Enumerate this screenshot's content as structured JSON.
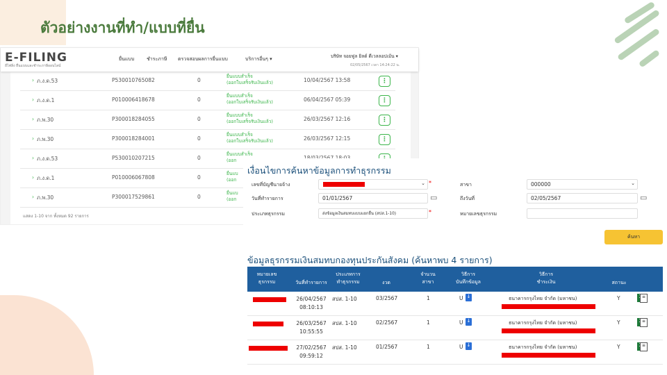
{
  "slide_title": "ตัวอย่างงานที่ทำ/แบบที่ยื่น",
  "efiling": {
    "logo": "E-FILING",
    "logo_sub": "อีไฟลิ่ง ยื่นแบบและชำระภาษีออนไลน์",
    "nav": [
      "ยื่นแบบ",
      "ชำระภาษี",
      "ตรวจสอบผลการยื่นแบบ",
      "บริการอื่นๆ ▾"
    ],
    "user": "บริษัท จอยฟูล ยิลด์ ดีเวลลอปเม้น ▾",
    "user_datetime": "02/05/2567 เวลา 14:24:22 น.",
    "rows": [
      {
        "form": "ภ.ง.ด.53",
        "ref": "P530010765082",
        "amount": "0",
        "status1": "ยื่นแบบสำเร็จ",
        "status2": "(ออกใบเสร็จรับเงินแล้ว)",
        "datetime": "10/04/2567 13:58"
      },
      {
        "form": "ภ.ง.ด.1",
        "ref": "P010006418678",
        "amount": "0",
        "status1": "ยื่นแบบสำเร็จ",
        "status2": "(ออกใบเสร็จรับเงินแล้ว)",
        "datetime": "06/04/2567 05:39"
      },
      {
        "form": "ภ.พ.30",
        "ref": "P300018284055",
        "amount": "0",
        "status1": "ยื่นแบบสำเร็จ",
        "status2": "(ออกใบเสร็จรับเงินแล้ว)",
        "datetime": "26/03/2567 12:16"
      },
      {
        "form": "ภ.พ.30",
        "ref": "P300018284001",
        "amount": "0",
        "status1": "ยื่นแบบสำเร็จ",
        "status2": "(ออกใบเสร็จรับเงินแล้ว)",
        "datetime": "26/03/2567 12:15"
      },
      {
        "form": "ภ.ง.ด.53",
        "ref": "P530010207215",
        "amount": "0",
        "status1": "ยื่นแบบสำเร็จ",
        "status2": "(ออก",
        "datetime": "18/03/2567 18:03"
      },
      {
        "form": "ภ.ง.ด.1",
        "ref": "P010006067808",
        "amount": "0",
        "status1": "ยื่นแบ",
        "status2": "(ออก",
        "datetime": ""
      },
      {
        "form": "ภ.พ.30",
        "ref": "P300017529861",
        "amount": "0",
        "status1": "ยื่นแบ",
        "status2": "(ออก",
        "datetime": ""
      }
    ],
    "footer": "แสดง 1-10 จาก ทั้งหมด 92 รายการ"
  },
  "sso": {
    "search_title": "เงื่อนไขการค้นหาข้อมูลการทำธุรกรรม",
    "labels": {
      "employer_acct": "เลขที่บัญชีนายจ้าง",
      "branch": "สาขา",
      "date_from": "วันที่ทำรายการ",
      "date_to": "ถึงวันที่",
      "txn_type": "ประเภทธุรกรรม",
      "txn_no": "หมายเลขธุรกรรม"
    },
    "values": {
      "branch": "000000",
      "date_from": "01/01/2567",
      "date_to": "02/05/2567",
      "txn_type": "ส่งข้อมูลเงินสมทบแบบแยกยื่น (สปส.1-10)",
      "txn_no": ""
    },
    "search_button": "ค้นหา",
    "results_title": "ข้อมูลธุรกรรมเงินสมทบกองทุนประกันสังคม (ค้นหาพบ 4 รายการ)",
    "headers": [
      "หมายเลข\nธุรกรรม",
      "วันที่ทำรายการ",
      "ประเภทการ\nทำธุรกรรม",
      "งวด",
      "จำนวน\nสาขา",
      "วิธีการ\nบันทึกข้อมูล",
      "วิธีการ\nชำระเงิน",
      "สถานะ"
    ],
    "rows": [
      {
        "date": "26/04/2567",
        "time": "08:10:13",
        "type": "สปส. 1-10",
        "period": "03/2567",
        "branches": "1",
        "method": "U",
        "bank": "ธนาคารกรุงไทย จำกัด (มหาชน)",
        "status": "Y"
      },
      {
        "date": "26/03/2567",
        "time": "10:55:55",
        "type": "สปส. 1-10",
        "period": "02/2567",
        "branches": "1",
        "method": "U",
        "bank": "ธนาคารกรุงไทย จำกัด (มหาชน)",
        "status": "Y"
      },
      {
        "date": "27/02/2567",
        "time": "09:59:12",
        "type": "สปส. 1-10",
        "period": "01/2567",
        "branches": "1",
        "method": "U",
        "bank": "ธนาคารกรุงไทย จำกัด (มหาชน)",
        "status": "Y"
      }
    ]
  }
}
